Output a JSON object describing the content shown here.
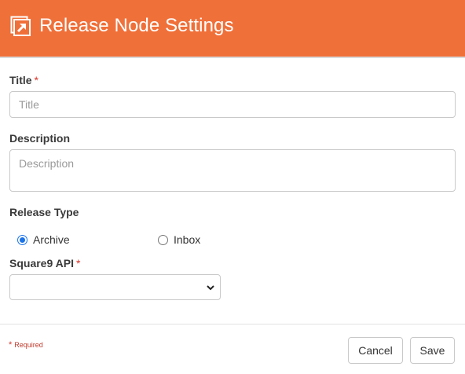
{
  "header": {
    "title": "Release Node Settings",
    "icon": "export-box-icon",
    "background": "#f0703a"
  },
  "form": {
    "title_label": "Title",
    "title_required_mark": "*",
    "title_placeholder": "Title",
    "title_value": "",
    "description_label": "Description",
    "description_placeholder": "Description",
    "description_value": "",
    "release_type_label": "Release Type",
    "release_type_options": [
      {
        "label": "Archive",
        "selected": true
      },
      {
        "label": "Inbox",
        "selected": false
      }
    ],
    "api_label": "Square9 API",
    "api_required_mark": "*",
    "api_selected": ""
  },
  "footer": {
    "required_star": "*",
    "required_text": "Required",
    "cancel_label": "Cancel",
    "save_label": "Save"
  },
  "colors": {
    "accent": "#f0703a",
    "required": "#d9362b",
    "radio_selected": "#1a73e8"
  }
}
